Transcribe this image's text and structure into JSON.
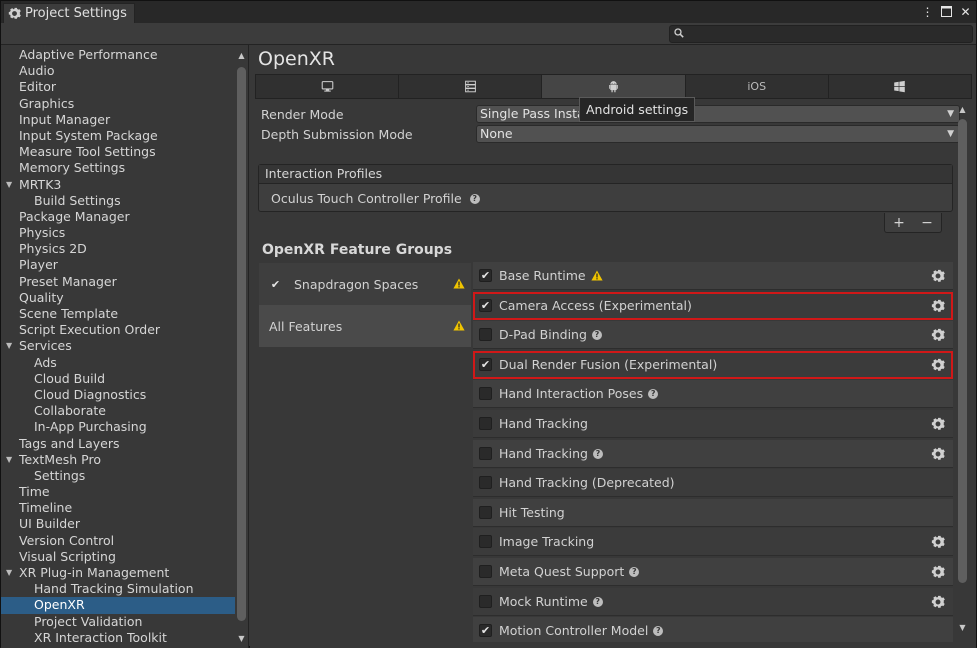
{
  "window": {
    "tab_title": "Project Settings"
  },
  "search": {
    "placeholder": ""
  },
  "sidebar": {
    "items": [
      {
        "label": "Adaptive Performance",
        "level": 0
      },
      {
        "label": "Audio",
        "level": 0
      },
      {
        "label": "Editor",
        "level": 0
      },
      {
        "label": "Graphics",
        "level": 0
      },
      {
        "label": "Input Manager",
        "level": 0
      },
      {
        "label": "Input System Package",
        "level": 0
      },
      {
        "label": "Measure Tool Settings",
        "level": 0
      },
      {
        "label": "Memory Settings",
        "level": 0
      },
      {
        "label": "MRTK3",
        "level": 0,
        "expanded": true
      },
      {
        "label": "Build Settings",
        "level": 1
      },
      {
        "label": "Package Manager",
        "level": 0
      },
      {
        "label": "Physics",
        "level": 0
      },
      {
        "label": "Physics 2D",
        "level": 0
      },
      {
        "label": "Player",
        "level": 0
      },
      {
        "label": "Preset Manager",
        "level": 0
      },
      {
        "label": "Quality",
        "level": 0
      },
      {
        "label": "Scene Template",
        "level": 0
      },
      {
        "label": "Script Execution Order",
        "level": 0
      },
      {
        "label": "Services",
        "level": 0,
        "expanded": true
      },
      {
        "label": "Ads",
        "level": 1
      },
      {
        "label": "Cloud Build",
        "level": 1
      },
      {
        "label": "Cloud Diagnostics",
        "level": 1
      },
      {
        "label": "Collaborate",
        "level": 1
      },
      {
        "label": "In-App Purchasing",
        "level": 1
      },
      {
        "label": "Tags and Layers",
        "level": 0
      },
      {
        "label": "TextMesh Pro",
        "level": 0,
        "expanded": true
      },
      {
        "label": "Settings",
        "level": 1
      },
      {
        "label": "Time",
        "level": 0
      },
      {
        "label": "Timeline",
        "level": 0
      },
      {
        "label": "UI Builder",
        "level": 0
      },
      {
        "label": "Version Control",
        "level": 0
      },
      {
        "label": "Visual Scripting",
        "level": 0
      },
      {
        "label": "XR Plug-in Management",
        "level": 0,
        "expanded": true
      },
      {
        "label": "Hand Tracking Simulation",
        "level": 1
      },
      {
        "label": "OpenXR",
        "level": 1,
        "selected": true
      },
      {
        "label": "Project Validation",
        "level": 1
      },
      {
        "label": "XR Interaction Toolkit",
        "level": 1
      }
    ]
  },
  "main": {
    "title": "OpenXR",
    "platform_tabs": [
      {
        "name": "desktop",
        "icon": "monitor-icon",
        "label": ""
      },
      {
        "name": "server",
        "icon": "server-icon",
        "label": ""
      },
      {
        "name": "android",
        "icon": "android-icon",
        "label": "",
        "active": true
      },
      {
        "name": "ios",
        "icon": "",
        "label": "iOS"
      },
      {
        "name": "windows",
        "icon": "windows-icon",
        "label": ""
      }
    ],
    "tooltip": "Android settings",
    "render_mode": {
      "label": "Render Mode",
      "value": "Single Pass Instanc"
    },
    "depth_mode": {
      "label": "Depth Submission Mode",
      "value": "None"
    },
    "interaction_profiles": {
      "header": "Interaction Profiles",
      "items": [
        "Oculus Touch Controller Profile"
      ],
      "plus": "+",
      "minus": "−"
    },
    "feature_groups": {
      "title": "OpenXR Feature Groups",
      "groups": [
        {
          "label": "Snapdragon Spaces",
          "checked": true,
          "warning": true
        },
        {
          "label": "All Features",
          "checked": false,
          "warning": true,
          "selected": true
        }
      ],
      "features": [
        {
          "label": "Base Runtime",
          "checked": true,
          "warning": true,
          "help": false,
          "gear": true,
          "highlight": false
        },
        {
          "label": "Camera Access (Experimental)",
          "checked": true,
          "warning": false,
          "help": false,
          "gear": true,
          "highlight": true
        },
        {
          "label": "D-Pad Binding",
          "checked": false,
          "warning": false,
          "help": true,
          "gear": true,
          "highlight": false
        },
        {
          "label": "Dual Render Fusion (Experimental)",
          "checked": true,
          "warning": false,
          "help": false,
          "gear": true,
          "highlight": true
        },
        {
          "label": "Hand Interaction Poses",
          "checked": false,
          "warning": false,
          "help": true,
          "gear": false,
          "highlight": false
        },
        {
          "label": "Hand Tracking",
          "checked": false,
          "warning": false,
          "help": false,
          "gear": true,
          "highlight": false
        },
        {
          "label": "Hand Tracking",
          "checked": false,
          "warning": false,
          "help": true,
          "gear": true,
          "highlight": false
        },
        {
          "label": "Hand Tracking (Deprecated)",
          "checked": false,
          "warning": false,
          "help": false,
          "gear": false,
          "highlight": false
        },
        {
          "label": "Hit Testing",
          "checked": false,
          "warning": false,
          "help": false,
          "gear": false,
          "highlight": false
        },
        {
          "label": "Image Tracking",
          "checked": false,
          "warning": false,
          "help": false,
          "gear": true,
          "highlight": false
        },
        {
          "label": "Meta Quest Support",
          "checked": false,
          "warning": false,
          "help": true,
          "gear": true,
          "highlight": false
        },
        {
          "label": "Mock Runtime",
          "checked": false,
          "warning": false,
          "help": true,
          "gear": true,
          "highlight": false
        },
        {
          "label": "Motion Controller Model",
          "checked": true,
          "warning": false,
          "help": true,
          "gear": false,
          "highlight": false
        }
      ]
    }
  },
  "colors": {
    "selection": "#2c5d87",
    "highlight": "#d01818",
    "warning": "#f0c400"
  }
}
